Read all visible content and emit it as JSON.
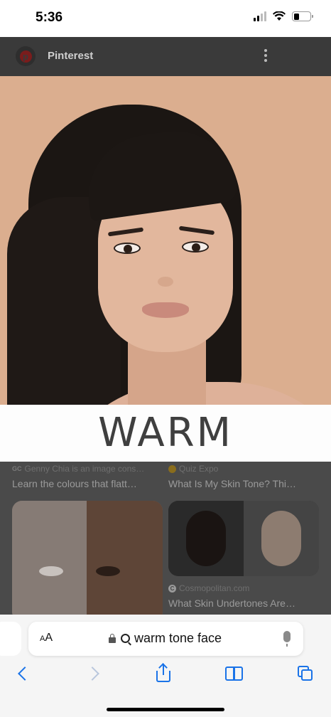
{
  "status_bar": {
    "time": "5:36",
    "battery_level": 0.35
  },
  "pinterest": {
    "title": "Pinterest"
  },
  "hero_image": {
    "overlay_word": "WARM"
  },
  "results": [
    {
      "source": "Genny Chia is an image cons…",
      "source_icon": "gc-logo-icon",
      "caption": "Learn the colours that flatt…"
    },
    {
      "source": "Quiz Expo",
      "source_icon": "quiz-expo-icon",
      "caption": "What Is My Skin Tone? Thi…"
    },
    {
      "source": "Cosmopolitan.com",
      "source_icon": "cosmopolitan-icon",
      "caption": "What Skin Undertones Are…"
    }
  ],
  "browser": {
    "text_size_label": "AA",
    "address": "warm tone face"
  },
  "colors": {
    "accent": "#1a73e8",
    "hero_bg": "#dbae8f",
    "dim_overlay": "#4a4a4a"
  }
}
